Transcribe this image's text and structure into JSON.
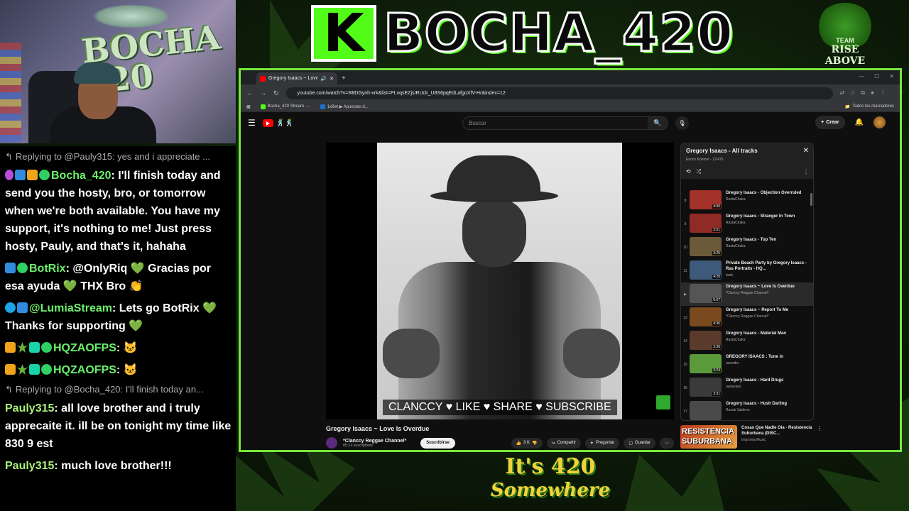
{
  "overlay": {
    "logo_letter": "K",
    "logo_text": "BOCHA_420",
    "team_badge_top": "TEAM",
    "team_badge_bottom": "RISE ABOVE",
    "bottom_logo_line1": "It's 420",
    "bottom_logo_line2": "Somewhere",
    "webcam_wall_text": "BOCHA 420",
    "accent_green": "#53fc18",
    "frame_green": "#77e83c"
  },
  "chat": {
    "messages": [
      {
        "type": "reply",
        "text": "Replying to @Pauly315: yes and i appreciate ..."
      },
      {
        "type": "msg",
        "user": "Bocha_420",
        "text": "I'll finish today and send you the hosty, bro, or tomorrow when we're both available. You have my support, it's nothing to me! Just press hosty, Pauly, and that's it, hahaha"
      },
      {
        "type": "msg",
        "user": "BotRix",
        "text": "@OnlyRiq 💚 Gracias por esa ayuda 💚 THX Bro 👏"
      },
      {
        "type": "msg",
        "user": "@LumiaStream",
        "text": "Lets go BotRix 💚 Thanks for supporting 💚"
      },
      {
        "type": "msg",
        "user": "HQZAOFPS",
        "text": ""
      },
      {
        "type": "msg",
        "user": "HQZAOFPS",
        "text": ""
      },
      {
        "type": "reply",
        "text": "Replying to @Bocha_420: I'll finish today an..."
      },
      {
        "type": "msg",
        "user": "Pauly315",
        "text": "all love brother and i truly apprecaite it. ill be on tonight my time like 830 9 est"
      },
      {
        "type": "msg",
        "user": "Pauly315",
        "text": "much love brother!!!"
      }
    ]
  },
  "browser": {
    "tab_title": "Gregory Isaacs ~ Love Is Ov",
    "url": "youtube.com/watch?v=R8DGynh-vrk&list=PLvqsEZjsIRUck_U8S6pqEdLafgoXfV-Hr&index=12",
    "bookmarks": [
      "Bocha_420 Stream -...",
      "1xBet ▶ Apuestas d..."
    ],
    "all_bookmarks": "Todos los marcadores"
  },
  "youtube": {
    "search_placeholder": "Buscar",
    "create_label": "Crear",
    "video_caption": "CLANCCY ♥ LIKE ♥ SHARE ♥ SUBSCRIBE",
    "video_title": "Gregory Isaacs ~ Love Is Overdue",
    "channel_name": "*Clanccy Reggae Channel*",
    "channel_subs": "85.3 k suscriptores",
    "subscribe_label": "Suscribirse",
    "like_count": "3 K",
    "share_label": "Compartir",
    "ask_label": "Preguntar",
    "save_label": "Guardar"
  },
  "playlist": {
    "title": "Gregory Isaacs - All tracks",
    "subtitle": "Enrico Kohinor - 12/476",
    "items": [
      {
        "num": "8",
        "title": "Gregory Isaacs - Objection Overruled",
        "channel": "RastaChaka",
        "duration": "4:00",
        "color": "#a3322a"
      },
      {
        "num": "9",
        "title": "Gregory Isaacs - Stranger In Town",
        "channel": "RastaChaka",
        "duration": "3:51",
        "color": "#8f2b24"
      },
      {
        "num": "10",
        "title": "Gregory Isaacs - Top Ten",
        "channel": "RastaChaka",
        "duration": "3:25",
        "color": "#6b5a3a"
      },
      {
        "num": "11",
        "title": "Private Beach Party by Gregory Isaacs - Ras Portraits - HQ...",
        "channel": "iwek",
        "duration": "4:20",
        "color": "#3e5a7a"
      },
      {
        "num": "▶",
        "title": "Gregory Isaacs ~ Love Is Overdue",
        "channel": "*Clanccy Reggae Channel*",
        "duration": "6:07",
        "color": "#555555",
        "active": true
      },
      {
        "num": "13",
        "title": "Gregory Isaacs ~ Report To Me",
        "channel": "*Clanccy Reggae Channel*",
        "duration": "4:36",
        "color": "#7a4a1e"
      },
      {
        "num": "14",
        "title": "Gregory Isaacs - Material Man",
        "channel": "RastaChaka",
        "duration": "3:36",
        "color": "#5a3a2a"
      },
      {
        "num": "15",
        "title": "GREGORY ISAACS : Tune in",
        "channel": "rasorder",
        "duration": "3:24",
        "color": "#5a9a3a"
      },
      {
        "num": "16",
        "title": "Gregory Isaacs - Hard Drugs",
        "channel": "rastaviejo",
        "duration": "3:31",
        "color": "#3a3a3a"
      },
      {
        "num": "17",
        "title": "Gregory Isaacs - Hush Darling",
        "channel": "Rusak Valdenn",
        "duration": "",
        "color": "#4a4a4a"
      }
    ]
  },
  "recommended": {
    "thumb_text": "RESISTENCIA SUBURBANA",
    "title": "Cosas Que Nadie Oia - Resistencia Suburbana (DISC...",
    "channel": "Impronta Music"
  }
}
